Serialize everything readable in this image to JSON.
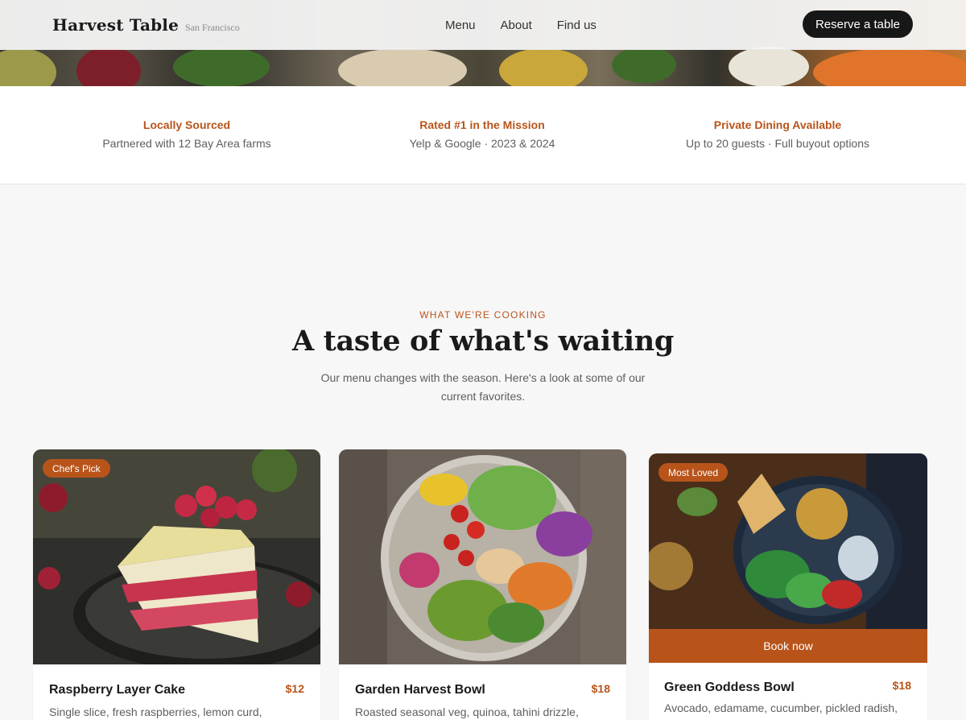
{
  "nav": {
    "brand_name": "Harvest Table",
    "brand_city": "San Francisco",
    "links": [
      "Menu",
      "About",
      "Find us"
    ],
    "cta": "Reserve a table"
  },
  "features": [
    {
      "title": "Locally Sourced",
      "subtitle": "Partnered with 12 Bay Area farms"
    },
    {
      "title": "Rated #1 in the Mission",
      "subtitle": "Yelp & Google · 2023 & 2024"
    },
    {
      "title": "Private Dining Available",
      "subtitle": "Up to 20 guests · Full buyout options"
    }
  ],
  "section": {
    "eyebrow": "WHAT WE'RE COOKING",
    "title": "A taste of what's waiting",
    "subtitle": "Our menu changes with the season. Here's a look at some of our current favorites."
  },
  "cards": [
    {
      "badge": "Chef's Pick",
      "name": "Raspberry Layer Cake",
      "price": "$12",
      "description": "Single slice, fresh raspberries, lemon curd,"
    },
    {
      "badge": "",
      "name": "Garden Harvest Bowl",
      "price": "$18",
      "description": "Roasted seasonal veg, quinoa, tahini drizzle,"
    },
    {
      "badge": "Most Loved",
      "name": "Green Goddess Bowl",
      "price": "$18",
      "description": "Avocado, edamame, cucumber, pickled radish,",
      "button": "Book now"
    }
  ],
  "colors": {
    "accent": "#b8541a",
    "dark": "#171717",
    "background": "#f7f7f7"
  }
}
